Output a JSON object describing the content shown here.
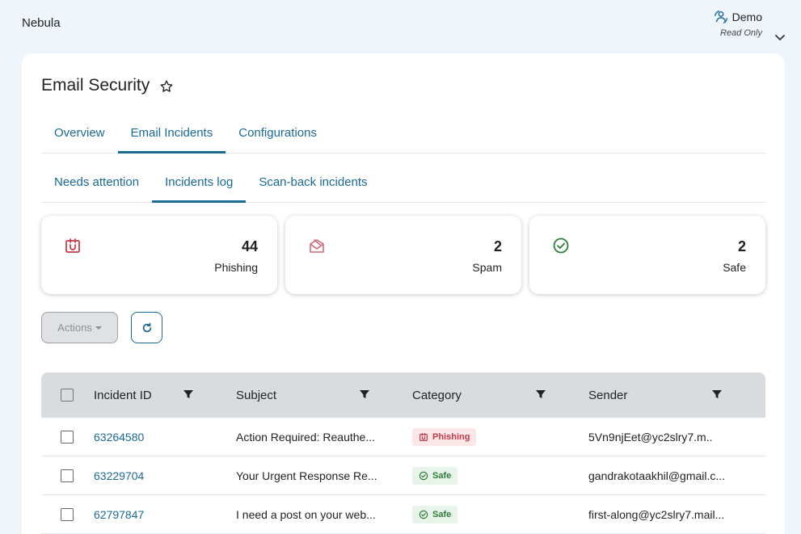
{
  "app": {
    "name": "Nebula"
  },
  "user": {
    "name": "Demo",
    "role": "Read Only"
  },
  "page": {
    "title": "Email Security"
  },
  "main_tabs": [
    {
      "label": "Overview",
      "active": false
    },
    {
      "label": "Email Incidents",
      "active": true
    },
    {
      "label": "Configurations",
      "active": false
    }
  ],
  "sub_tabs": [
    {
      "label": "Needs attention",
      "active": false
    },
    {
      "label": "Incidents log",
      "active": true
    },
    {
      "label": "Scan-back incidents",
      "active": false
    }
  ],
  "stats": [
    {
      "icon": "phishing-icon",
      "count": "44",
      "label": "Phishing",
      "color": "#c43a48"
    },
    {
      "icon": "spam-icon",
      "count": "2",
      "label": "Spam",
      "color": "#d06a78"
    },
    {
      "icon": "safe-icon",
      "count": "2",
      "label": "Safe",
      "color": "#2e7d3a"
    }
  ],
  "toolbar": {
    "actions_label": "Actions"
  },
  "table": {
    "columns": [
      "Incident ID",
      "Subject",
      "Category",
      "Sender"
    ],
    "rows": [
      {
        "id": "63264580",
        "subject": "Action Required: Reauthe...",
        "category": "Phishing",
        "sender": "5Vn9njEet@yc2slry7.m.."
      },
      {
        "id": "63229704",
        "subject": "Your Urgent Response Re...",
        "category": "Safe",
        "sender": "gandrakotaakhil@gmail.c..."
      },
      {
        "id": "62797847",
        "subject": "I need a post on your web...",
        "category": "Safe",
        "sender": "first-along@yc2slry7.mail..."
      }
    ]
  },
  "colors": {
    "accent": "#1a6a96",
    "phishing": "#c43a48",
    "safe": "#2e7d3a",
    "background": "#eef5fb"
  }
}
